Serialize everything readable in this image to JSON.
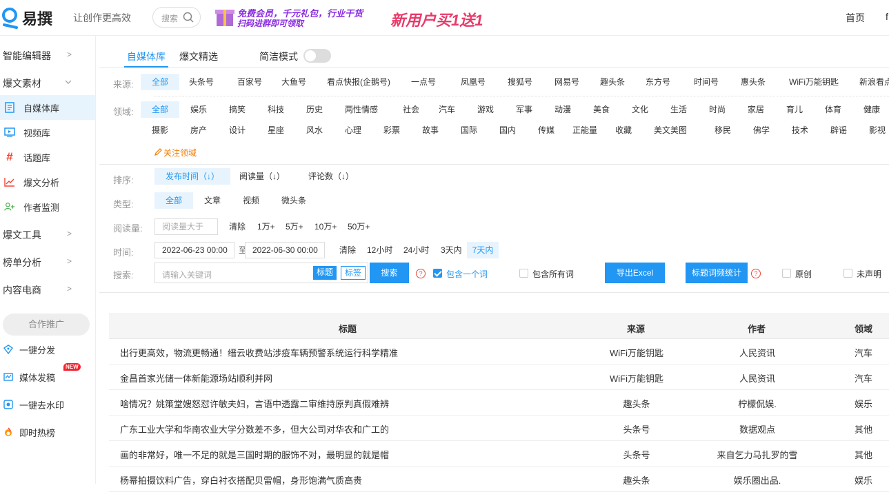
{
  "header": {
    "logo_text": "易撰",
    "slogan": "让创作更高效",
    "search_placeholder": "搜索",
    "banner1_line1": "免费会员，千元礼包，行业干货",
    "banner1_line2": "扫码进群即可领取",
    "banner2_text": "新用户买1送1",
    "nav_home": "首页",
    "nav_more": "f"
  },
  "sidebar": {
    "smart_editor": "智能编辑器",
    "viral_material": "爆文素材",
    "sub_items": [
      {
        "label": "自媒体库",
        "icon": "document-icon",
        "active": true
      },
      {
        "label": "视频库",
        "icon": "video-icon",
        "active": false
      },
      {
        "label": "话题库",
        "icon": "hashtag-icon",
        "active": false
      },
      {
        "label": "爆文分析",
        "icon": "chart-line-icon",
        "active": false
      },
      {
        "label": "作者监测",
        "icon": "user-add-icon",
        "active": false
      }
    ],
    "viral_tools": "爆文工具",
    "rank_analysis": "榜单分析",
    "content_ecommerce": "内容电商",
    "coop_label": "合作推广",
    "tools": [
      {
        "label": "一键分发",
        "icon": "distribute-icon"
      },
      {
        "label": "媒体发稿",
        "icon": "media-icon",
        "badge": "NEW"
      },
      {
        "label": "一键去水印",
        "icon": "watermark-icon"
      },
      {
        "label": "即时热榜",
        "icon": "fire-icon"
      }
    ]
  },
  "tabs": {
    "items": [
      "自媒体库",
      "爆文精选"
    ],
    "active": "自媒体库",
    "simple_mode_label": "简洁模式",
    "simple_mode_on": false
  },
  "filters": {
    "source_label": "来源:",
    "sources": [
      "全部",
      "头条号",
      "百家号",
      "大鱼号",
      "看点快报(企鹅号)",
      "一点号",
      "凤凰号",
      "搜狐号",
      "网易号",
      "趣头条",
      "东方号",
      "时间号",
      "惠头条",
      "WiFi万能钥匙",
      "新浪看点"
    ],
    "domain_label": "领域:",
    "domains_row1": [
      "全部",
      "娱乐",
      "搞笑",
      "科技",
      "历史",
      "两性情感",
      "社会",
      "汽车",
      "游戏",
      "军事",
      "动漫",
      "美食",
      "文化",
      "生活",
      "时尚",
      "家居",
      "育儿",
      "体育",
      "健康"
    ],
    "domains_row2": [
      "摄影",
      "房产",
      "设计",
      "星座",
      "风水",
      "心理",
      "彩票",
      "故事",
      "国际",
      "国内",
      "传媒",
      "正能量",
      "收藏",
      "美文美图",
      "移民",
      "佛学",
      "技术",
      "辟谣",
      "影视"
    ],
    "follow_domain": "关注领域",
    "sort_label": "排序:",
    "sorts": [
      "发布时间（↓）",
      "阅读量（↓）",
      "评论数（↓）"
    ],
    "type_label": "类型:",
    "types": [
      "全部",
      "文章",
      "视频",
      "微头条"
    ],
    "read_label": "阅读量:",
    "read_placeholder": "阅读量大于",
    "read_opts": [
      "清除",
      "1万+",
      "5万+",
      "10万+",
      "50万+"
    ],
    "time_label": "时间:",
    "date_from": "2022-06-23 00:00",
    "date_to_sep": "至",
    "date_to": "2022-06-30 00:00",
    "time_opts": [
      "清除",
      "12小时",
      "24小时",
      "3天内",
      "7天内"
    ],
    "search_label": "搜索:",
    "kw_placeholder": "请输入关键词",
    "tag_title": "标题",
    "tag_tag": "标签",
    "search_btn": "搜索",
    "help_mark": "?",
    "contains_one": "包含一个词",
    "contains_one_checked": true,
    "contains_all": "包含所有词",
    "export_btn": "导出Excel",
    "stats_btn": "标题词频统计",
    "original": "原创",
    "undeclared": "未声明"
  },
  "table": {
    "headers": {
      "title": "标题",
      "source": "来源",
      "author": "作者",
      "domain": "领域"
    },
    "rows": [
      {
        "title": "出行更高效，物流更畅通！缙云收费站涉疫车辆预警系统运行科学精准",
        "source": "WiFi万能钥匙",
        "author": "人民资讯",
        "domain": "汽车"
      },
      {
        "title": "金昌首家光储一体新能源场站顺利并网",
        "source": "WiFi万能钥匙",
        "author": "人民资讯",
        "domain": "汽车"
      },
      {
        "title": "啥情况？姚策堂嫂怒怼许敏夫妇，言语中透露二审维持原判真假难辨",
        "source": "趣头条",
        "author": "柠檬侃娱.",
        "domain": "娱乐"
      },
      {
        "title": "广东工业大学和华南农业大学分数差不多，但大公司对华农和广工的",
        "source": "头条号",
        "author": "数据观点",
        "domain": "其他"
      },
      {
        "title": "画的非常好，唯一不足的就是三国时期的服饰不对，最明显的就是帽",
        "source": "头条号",
        "author": "来自乞力马扎罗的雪",
        "domain": "其他"
      },
      {
        "title": "杨幂拍摄饮料广告，穿白衬衣搭配贝雷帽，身形饱满气质高贵",
        "source": "趣头条",
        "author": "娱乐圈出品.",
        "domain": "娱乐"
      }
    ]
  },
  "colors": {
    "accent": "#2196f3",
    "selected_bg": "#e8f4fd",
    "warning": "#f57c00"
  }
}
